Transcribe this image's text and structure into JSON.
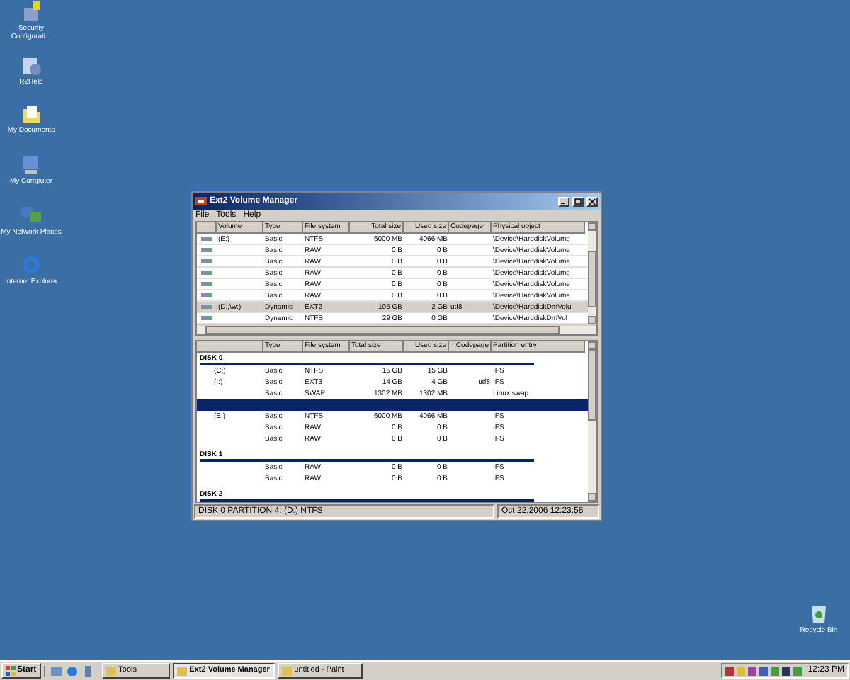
{
  "desktop_icons": [
    {
      "label": "Security Configurati..."
    },
    {
      "label": "R2Help"
    },
    {
      "label": "My Documents"
    },
    {
      "label": "My Computer"
    },
    {
      "label": "My Network Places"
    },
    {
      "label": "Internet Explorer"
    }
  ],
  "window": {
    "title": "Ext2 Volume Manager",
    "menu": [
      "File",
      "Tools",
      "Help"
    ],
    "volumes": {
      "columns": [
        "Volume",
        "Type",
        "File system",
        "Total size",
        "Used size",
        "Codepage",
        "Physical object"
      ],
      "rows": [
        {
          "volume": "(E:)",
          "type": "Basic",
          "file_system": "NTFS",
          "total_size": "6000 MB",
          "used_size": "4066 MB",
          "codepage": "",
          "physical_object": "\\Device\\HarddiskVolume",
          "selected": false
        },
        {
          "volume": "",
          "type": "Basic",
          "file_system": "RAW",
          "total_size": "0 B",
          "used_size": "0 B",
          "codepage": "",
          "physical_object": "\\Device\\HarddiskVolume",
          "selected": false
        },
        {
          "volume": "",
          "type": "Basic",
          "file_system": "RAW",
          "total_size": "0 B",
          "used_size": "0 B",
          "codepage": "",
          "physical_object": "\\Device\\HarddiskVolume",
          "selected": false
        },
        {
          "volume": "",
          "type": "Basic",
          "file_system": "RAW",
          "total_size": "0 B",
          "used_size": "0 B",
          "codepage": "",
          "physical_object": "\\Device\\HarddiskVolume",
          "selected": false
        },
        {
          "volume": "",
          "type": "Basic",
          "file_system": "RAW",
          "total_size": "0 B",
          "used_size": "0 B",
          "codepage": "",
          "physical_object": "\\Device\\HarddiskVolume",
          "selected": false
        },
        {
          "volume": "",
          "type": "Basic",
          "file_system": "RAW",
          "total_size": "0 B",
          "used_size": "0 B",
          "codepage": "",
          "physical_object": "\\Device\\HarddiskVolume",
          "selected": false
        },
        {
          "volume": "(D:,\\w:)",
          "type": "Dynamic",
          "file_system": "EXT2",
          "total_size": "105 GB",
          "used_size": "2 GB",
          "codepage": "utf8",
          "physical_object": "\\Device\\HarddiskDmVolu",
          "selected": true
        },
        {
          "volume": "",
          "type": "Dynamic",
          "file_system": "NTFS",
          "total_size": "29 GB",
          "used_size": "0 GB",
          "codepage": "",
          "physical_object": "\\Device\\HarddiskDmVol",
          "selected": false
        }
      ]
    },
    "partitions": {
      "columns": [
        "",
        "Type",
        "File system",
        "Total size",
        "Used size",
        "Codepage",
        "Partition entry"
      ],
      "disks": [
        {
          "label": "DISK 0",
          "rows": [
            {
              "volume": "(C:)",
              "type": "Basic",
              "file_system": "NTFS",
              "total_size": "15 GB",
              "used_size": "15 GB",
              "codepage": "",
              "partition_entry": "IFS",
              "selected": false
            },
            {
              "volume": "(I:)",
              "type": "Basic",
              "file_system": "EXT3",
              "total_size": "14 GB",
              "used_size": "4 GB",
              "codepage": "utf8",
              "partition_entry": "IFS",
              "selected": false
            },
            {
              "volume": "",
              "type": "Basic",
              "file_system": "SWAP",
              "total_size": "1302 MB",
              "used_size": "1302 MB",
              "codepage": "",
              "partition_entry": "Linux swap",
              "selected": false
            },
            {
              "selected": true
            },
            {
              "volume": "(E:)",
              "type": "Basic",
              "file_system": "NTFS",
              "total_size": "6000 MB",
              "used_size": "4066 MB",
              "codepage": "",
              "partition_entry": "IFS",
              "selected": false
            },
            {
              "volume": "",
              "type": "Basic",
              "file_system": "RAW",
              "total_size": "0 B",
              "used_size": "0 B",
              "codepage": "",
              "partition_entry": "IFS",
              "selected": false
            },
            {
              "volume": "",
              "type": "Basic",
              "file_system": "RAW",
              "total_size": "0 B",
              "used_size": "0 B",
              "codepage": "",
              "partition_entry": "IFS",
              "selected": false
            }
          ]
        },
        {
          "label": "DISK 1",
          "rows": [
            {
              "volume": "",
              "type": "Basic",
              "file_system": "RAW",
              "total_size": "0 B",
              "used_size": "0 B",
              "codepage": "",
              "partition_entry": "IFS",
              "selected": false
            },
            {
              "volume": "",
              "type": "Basic",
              "file_system": "RAW",
              "total_size": "0 B",
              "used_size": "0 B",
              "codepage": "",
              "partition_entry": "IFS",
              "selected": false
            }
          ]
        },
        {
          "label": "DISK 2"
        }
      ]
    },
    "status_bar": [
      "DISK 0 PARTITION 4: (D:) NTFS",
      "Oct 22,2006 12:23:58"
    ]
  },
  "taskbar": {
    "start": "Start",
    "tasks": [
      {
        "label": "Tools",
        "selected": false
      },
      {
        "label": "Ext2 Volume Manager",
        "selected": true
      },
      {
        "label": "untitled - Paint",
        "selected": false
      }
    ],
    "clock": "12:23 PM"
  },
  "recycle_bin": {
    "label": "Recycle Bin"
  }
}
